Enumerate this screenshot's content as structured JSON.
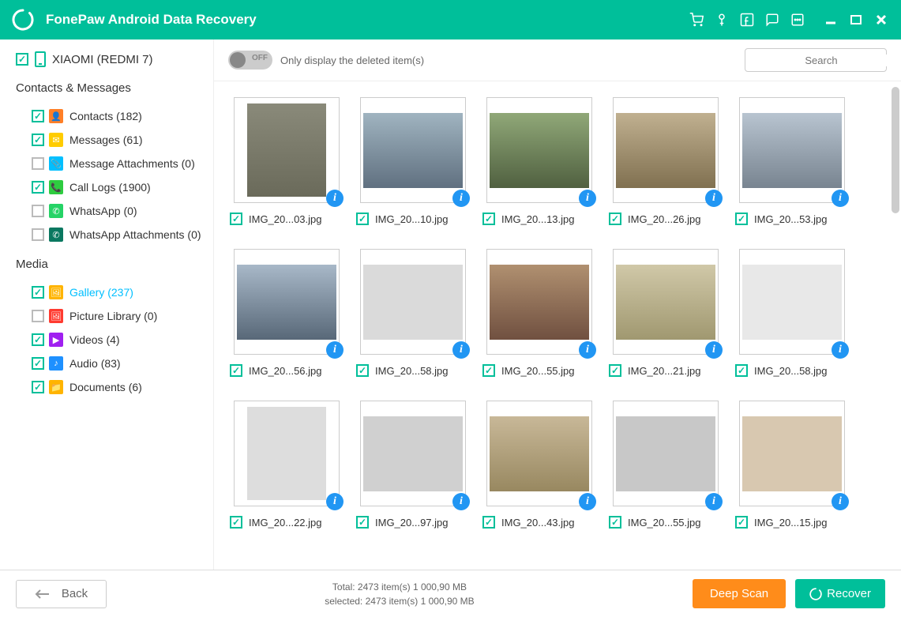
{
  "titlebar": {
    "title": "FonePaw Android Data Recovery"
  },
  "device": {
    "name": "XIAOMI (REDMI 7)"
  },
  "categories": [
    {
      "header": "Contacts & Messages",
      "items": [
        {
          "label": "Contacts",
          "count": "(182)",
          "checked": true,
          "color": "#ff7f27",
          "glyph": "👤"
        },
        {
          "label": "Messages",
          "count": "(61)",
          "checked": true,
          "color": "#ffcc00",
          "glyph": "✉"
        },
        {
          "label": "Message Attachments",
          "count": "(0)",
          "checked": false,
          "color": "#00bfff",
          "glyph": "📎"
        },
        {
          "label": "Call Logs",
          "count": "(1900)",
          "checked": true,
          "color": "#2ecc40",
          "glyph": "📞"
        },
        {
          "label": "WhatsApp",
          "count": "(0)",
          "checked": false,
          "color": "#25d366",
          "glyph": "✆"
        },
        {
          "label": "WhatsApp Attachments",
          "count": "(0)",
          "checked": false,
          "color": "#0a7860",
          "glyph": "✆"
        }
      ]
    },
    {
      "header": "Media",
      "items": [
        {
          "label": "Gallery",
          "count": "(237)",
          "checked": true,
          "color": "#ffb400",
          "glyph": "🖼",
          "active": true
        },
        {
          "label": "Picture Library",
          "count": "(0)",
          "checked": false,
          "color": "#ff3b30",
          "glyph": "🖼"
        },
        {
          "label": "Videos",
          "count": "(4)",
          "checked": true,
          "color": "#a020f0",
          "glyph": "▶"
        },
        {
          "label": "Audio",
          "count": "(83)",
          "checked": true,
          "color": "#1e90ff",
          "glyph": "♪"
        },
        {
          "label": "Documents",
          "count": "(6)",
          "checked": true,
          "color": "#ffb400",
          "glyph": "📁"
        }
      ]
    }
  ],
  "toolbar": {
    "toggle_label": "OFF",
    "hint": "Only display the deleted item(s)",
    "search_placeholder": "Search"
  },
  "gallery": [
    {
      "name": "IMG_20...03.jpg",
      "wide": false,
      "bg": "bg1"
    },
    {
      "name": "IMG_20...10.jpg",
      "wide": true,
      "bg": "bg2"
    },
    {
      "name": "IMG_20...13.jpg",
      "wide": true,
      "bg": "bg3"
    },
    {
      "name": "IMG_20...26.jpg",
      "wide": true,
      "bg": "bg4"
    },
    {
      "name": "IMG_20...53.jpg",
      "wide": true,
      "bg": "bg5"
    },
    {
      "name": "IMG_20...56.jpg",
      "wide": true,
      "bg": "bg6"
    },
    {
      "name": "IMG_20...58.jpg",
      "wide": true,
      "bg": "bg7"
    },
    {
      "name": "IMG_20...55.jpg",
      "wide": true,
      "bg": "bg8"
    },
    {
      "name": "IMG_20...21.jpg",
      "wide": true,
      "bg": "bg9"
    },
    {
      "name": "IMG_20...58.jpg",
      "wide": true,
      "bg": "bg10"
    },
    {
      "name": "IMG_20...22.jpg",
      "wide": false,
      "bg": "bg11"
    },
    {
      "name": "IMG_20...97.jpg",
      "wide": true,
      "bg": "bg12"
    },
    {
      "name": "IMG_20...43.jpg",
      "wide": true,
      "bg": "bg13"
    },
    {
      "name": "IMG_20...55.jpg",
      "wide": true,
      "bg": "bg14"
    },
    {
      "name": "IMG_20...15.jpg",
      "wide": true,
      "bg": "bg15"
    }
  ],
  "footer": {
    "back": "Back",
    "total": "Total: 2473 item(s) 1 000,90 MB",
    "selected": "selected: 2473 item(s) 1 000,90 MB",
    "deep_scan": "Deep Scan",
    "recover": "Recover"
  }
}
